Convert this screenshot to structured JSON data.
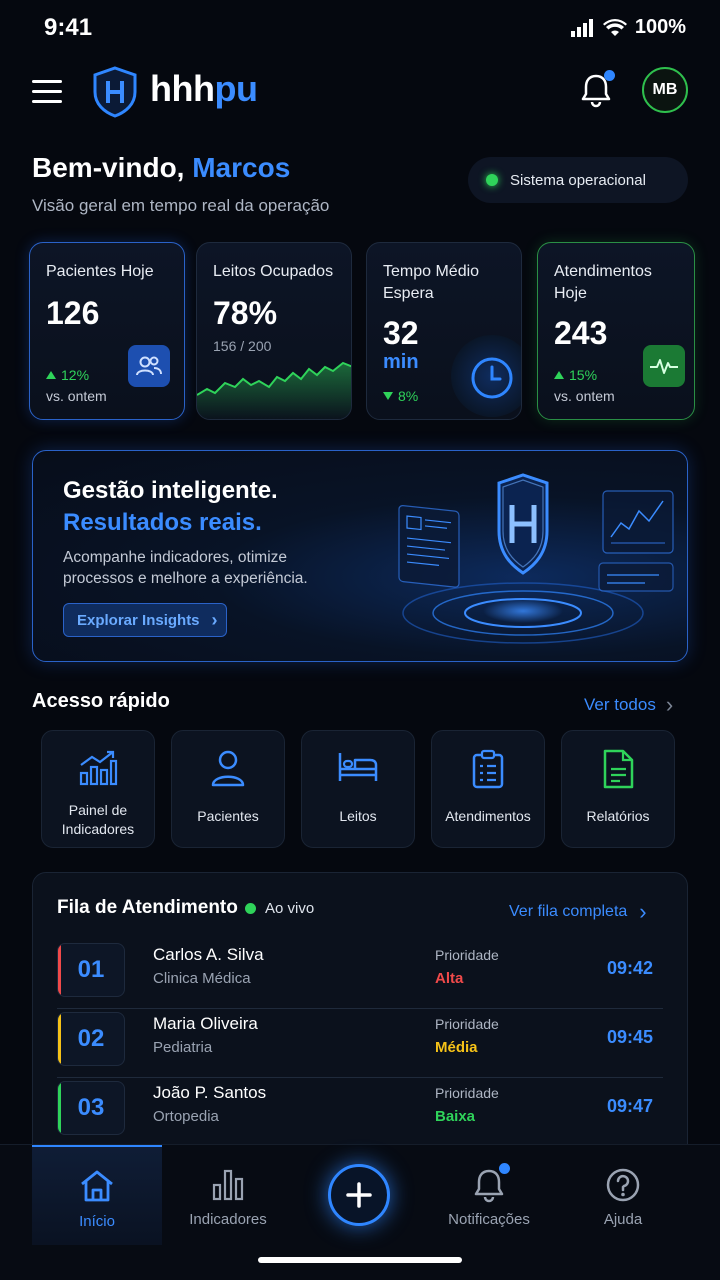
{
  "status_bar": {
    "time": "9:41",
    "battery": "100%"
  },
  "header": {
    "brand_part1": "hhh",
    "brand_part2": "pu",
    "avatar_initials": "MB"
  },
  "welcome": {
    "greeting": "Bem-vindo, ",
    "name": "Marcos",
    "subtitle": "Visão geral em tempo real da operação",
    "system_status": "Sistema operacional"
  },
  "stats": [
    {
      "label": "Pacientes Hoje",
      "value": "126",
      "delta": "12%",
      "note": "vs. ontem",
      "icon": "users-icon"
    },
    {
      "label": "Leitos Ocupados",
      "value": "78%",
      "sub": "156 / 200",
      "icon": "sparkline"
    },
    {
      "label": "Tempo Médio Espera",
      "value": "32",
      "unit": "min",
      "delta": "8%",
      "icon": "clock-icon"
    },
    {
      "label": "Atendimentos Hoje",
      "value": "243",
      "delta": "15%",
      "note": "vs. ontem",
      "icon": "pulse-icon"
    }
  ],
  "banner": {
    "title": "Gestão inteligente.",
    "title_highlight": "Resultados reais.",
    "description": "Acompanhe indicadores, otimize processos e melhore a experiência.",
    "button": "Explorar Insights"
  },
  "quick_access": {
    "title": "Acesso rápido",
    "see_all": "Ver todos",
    "items": [
      {
        "label": "Painel de Indicadores",
        "icon": "chart-icon"
      },
      {
        "label": "Pacientes",
        "icon": "user-icon"
      },
      {
        "label": "Leitos",
        "icon": "bed-icon"
      },
      {
        "label": "Atendimentos",
        "icon": "clipboard-icon"
      },
      {
        "label": "Relatórios",
        "icon": "report-icon"
      }
    ]
  },
  "queue": {
    "title": "Fila de Atendimento",
    "live": "Ao vivo",
    "link": "Ver fila completa",
    "priority_label": "Prioridade",
    "rows": [
      {
        "number": "01",
        "name": "Carlos A. Silva",
        "dept": "Clinica Médica",
        "priority": "Alta",
        "priority_color": "#f04a4a",
        "time": "09:42"
      },
      {
        "number": "02",
        "name": "Maria Oliveira",
        "dept": "Pediatria",
        "priority": "Média",
        "priority_color": "#f5c218",
        "time": "09:45"
      },
      {
        "number": "03",
        "name": "João P. Santos",
        "dept": "Ortopedia",
        "priority": "Baixa",
        "priority_color": "#2fd35a",
        "time": "09:47"
      }
    ]
  },
  "bottom_nav": [
    {
      "label": "Início",
      "icon": "home-icon",
      "active": true
    },
    {
      "label": "Indicadores",
      "icon": "bar-chart-icon"
    },
    {
      "label": "",
      "icon": "plus-icon"
    },
    {
      "label": "Notificações",
      "icon": "bell-icon"
    },
    {
      "label": "Ajuda",
      "icon": "help-icon"
    }
  ],
  "colors": {
    "accent": "#3b8cff",
    "success": "#2fd35a",
    "background": "#05080f"
  }
}
